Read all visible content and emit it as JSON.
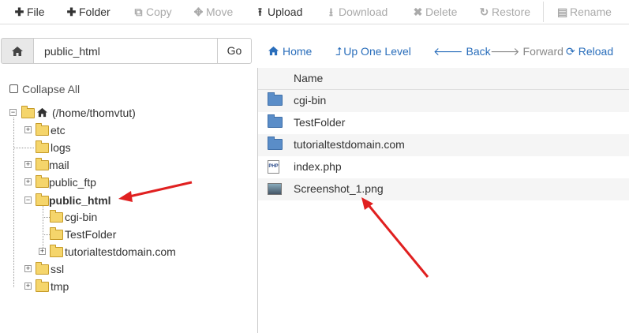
{
  "toolbar": {
    "buttons": [
      {
        "label": "File",
        "icon": "plus-icon",
        "enabled": true
      },
      {
        "label": "Folder",
        "icon": "plus-icon",
        "enabled": true
      },
      {
        "label": "Copy",
        "icon": "copy-icon",
        "enabled": false
      },
      {
        "label": "Move",
        "icon": "move-icon",
        "enabled": false
      },
      {
        "label": "Upload",
        "icon": "upload-icon",
        "enabled": true
      },
      {
        "label": "Download",
        "icon": "download-icon",
        "enabled": false
      },
      {
        "label": "Delete",
        "icon": "x-icon",
        "enabled": false
      },
      {
        "label": "Restore",
        "icon": "restore-icon",
        "enabled": false
      },
      {
        "label": "Rename",
        "icon": "file-icon",
        "enabled": false
      }
    ]
  },
  "address": {
    "path": "public_html",
    "go_label": "Go"
  },
  "nav": {
    "home": "Home",
    "up": "Up One Level",
    "back": "Back",
    "forward": "Forward",
    "reload": "Reload"
  },
  "tree": {
    "collapse_label": "Collapse All",
    "root": "(/home/thomvtut)",
    "items": [
      {
        "label": "etc"
      },
      {
        "label": "logs"
      },
      {
        "label": "mail"
      },
      {
        "label": "public_ftp"
      },
      {
        "label": "public_html",
        "selected": true
      },
      {
        "label": "cgi-bin"
      },
      {
        "label": "TestFolder"
      },
      {
        "label": "tutorialtestdomain.com"
      },
      {
        "label": "ssl"
      },
      {
        "label": "tmp"
      }
    ]
  },
  "files": {
    "header": "Name",
    "rows": [
      {
        "name": "cgi-bin",
        "type": "folder"
      },
      {
        "name": "TestFolder",
        "type": "folder"
      },
      {
        "name": "tutorialtestdomain.com",
        "type": "folder"
      },
      {
        "name": "index.php",
        "type": "php"
      },
      {
        "name": "Screenshot_1.png",
        "type": "image"
      }
    ]
  },
  "colors": {
    "link": "#2a6ebb",
    "annotation": "#e02020",
    "folder_yellow": "#f5d56b",
    "folder_blue": "#5a8dc8"
  }
}
